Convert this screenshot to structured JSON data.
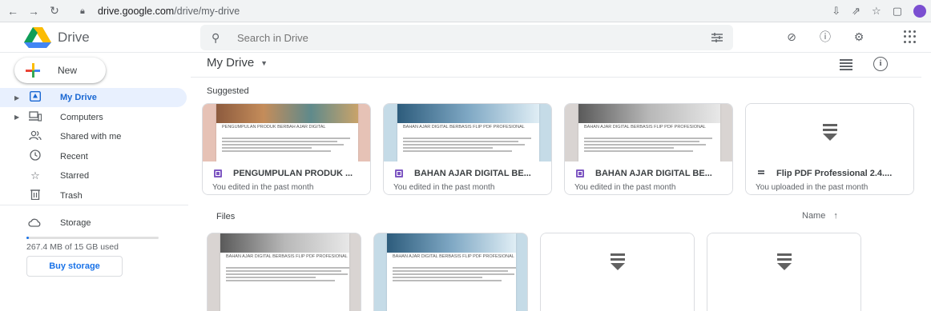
{
  "browser": {
    "url_domain": "drive.google.com",
    "url_path": "/drive/my-drive"
  },
  "header": {
    "app_name": "Drive",
    "search_placeholder": "Search in Drive"
  },
  "sidebar": {
    "new_label": "New",
    "items": [
      {
        "label": "My Drive",
        "icon": "my-drive-icon",
        "active": true,
        "expandable": true
      },
      {
        "label": "Computers",
        "icon": "computers-icon",
        "active": false,
        "expandable": true
      },
      {
        "label": "Shared with me",
        "icon": "shared-icon",
        "active": false,
        "expandable": false
      },
      {
        "label": "Recent",
        "icon": "clock-icon",
        "active": false,
        "expandable": false
      },
      {
        "label": "Starred",
        "icon": "star-icon",
        "active": false,
        "expandable": false
      },
      {
        "label": "Trash",
        "icon": "trash-icon",
        "active": false,
        "expandable": false
      }
    ],
    "storage_label": "Storage",
    "storage_used_text": "267.4 MB of 15 GB used",
    "storage_fraction": 0.018,
    "buy_storage_label": "Buy storage"
  },
  "main": {
    "title": "My Drive",
    "suggested_label": "Suggested",
    "files_label": "Files",
    "sort_label": "Name",
    "suggested": [
      {
        "title": "PENGUMPULAN PRODUK ...",
        "subtitle": "You edited in the past month",
        "type": "form",
        "doc_heading": "PENGUMPULAN PRODUK BERBAH AJAR DIGITAL",
        "thumb_bg": "#e6c2b6"
      },
      {
        "title": "BAHAN AJAR DIGITAL BE...",
        "subtitle": "You edited in the past month",
        "type": "form",
        "doc_heading": "BAHAN AJAR DIGITAL BERBASIS FLIP PDF PROFESIONAL",
        "thumb_bg": "#c5dbe7"
      },
      {
        "title": "BAHAN AJAR DIGITAL BE...",
        "subtitle": "You edited in the past month",
        "type": "form",
        "doc_heading": "BAHAN AJAR DIGITAL BERBASIS FLIP PDF PROFESIONAL",
        "thumb_bg": "#d9d4d2"
      },
      {
        "title": "Flip PDF Professional 2.4....",
        "subtitle": "You uploaded in the past month",
        "type": "file",
        "thumb_bg": "#ffffff"
      }
    ],
    "files": [
      {
        "type": "form",
        "doc_heading": "BAHAN AJAR DIGITAL BERBASIS FLIP PDF PROFESIONAL",
        "thumb_bg": "#d9d4d2"
      },
      {
        "type": "form",
        "doc_heading": "BAHAN AJAR DIGITAL BERBASIS FLIP PDF PROFESIONAL",
        "thumb_bg": "#c5dbe7"
      },
      {
        "type": "file",
        "thumb_bg": "#ffffff"
      },
      {
        "type": "file",
        "thumb_bg": "#ffffff"
      }
    ]
  },
  "colors": {
    "accent": "#1a73e8",
    "active_bg": "#e8f0fe",
    "form_purple": "#7e57c2"
  }
}
